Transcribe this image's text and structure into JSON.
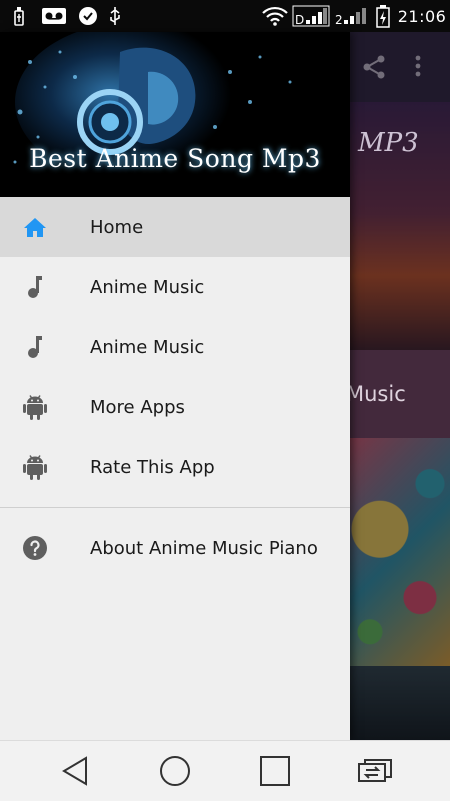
{
  "status_bar": {
    "time": "21:06",
    "icons": [
      "usb-icon",
      "voicemail-icon",
      "app-notification-icon",
      "usb-debug-icon",
      "wifi-icon",
      "signal-icon-1",
      "signal-icon-2",
      "battery-charging-icon"
    ]
  },
  "drawer": {
    "header_title": "Best Anime Song Mp3",
    "items": [
      {
        "label": "Home",
        "icon": "home-icon",
        "active": true
      },
      {
        "label": "Anime Music",
        "icon": "music-note-icon"
      },
      {
        "label": "Anime Music",
        "icon": "music-note-icon"
      },
      {
        "label": "More Apps",
        "icon": "android-icon"
      },
      {
        "label": "Rate This App",
        "icon": "android-icon"
      }
    ],
    "secondary_items": [
      {
        "label": "About Anime Music Piano",
        "icon": "help-icon"
      }
    ]
  },
  "background": {
    "card_label": "Music",
    "card_art_text": "MP3",
    "toolbar_icons": [
      "share-icon",
      "overflow-menu-icon"
    ]
  },
  "nav_bar": {
    "buttons": [
      "back-button",
      "home-button",
      "recents-button",
      "switch-apps-button"
    ]
  },
  "colors": {
    "accent": "#2196f3",
    "drawer_bg": "#efefef",
    "active_item_bg": "#d9d9d9",
    "icon_gray": "#5f5f5f"
  }
}
